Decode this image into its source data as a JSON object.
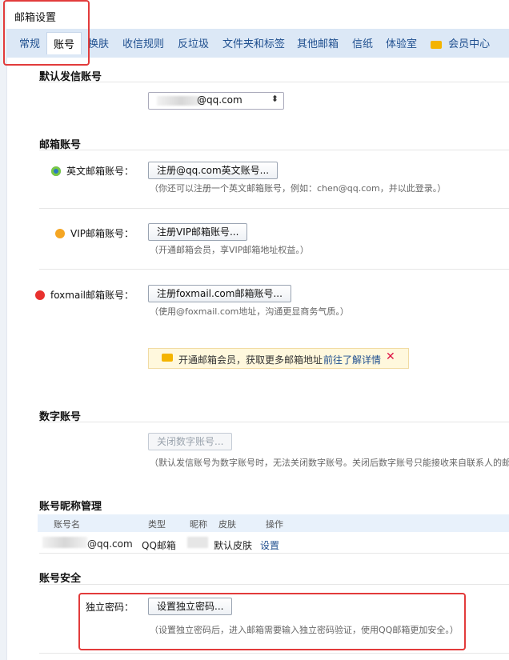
{
  "title": "邮箱设置",
  "tabs": [
    "常规",
    "账号",
    "换肤",
    "收信规则",
    "反垃圾",
    "文件夹和标签",
    "其他邮箱",
    "信纸",
    "体验室"
  ],
  "vip_tab": {
    "icon": "vip-icon",
    "label": "会员中心"
  },
  "default_sender": {
    "title": "默认发信账号",
    "value_suffix": "@qq.com"
  },
  "mail_accounts": {
    "title": "邮箱账号",
    "english": {
      "label": "英文邮箱账号：",
      "button": "注册@qq.com英文账号...",
      "hint": "（你还可以注册一个英文邮箱账号，例如：chen@qq.com，并以此登录。）"
    },
    "vip": {
      "label": "VIP邮箱账号：",
      "button": "注册VIP邮箱账号...",
      "hint": "（开通邮箱会员，享VIP邮箱地址权益。）"
    },
    "foxmail": {
      "label": "foxmail邮箱账号：",
      "button": "注册foxmail.com邮箱账号...",
      "hint": "（使用@foxmail.com地址，沟通更显商务气质。）"
    },
    "promo": {
      "text": "开通邮箱会员，获取更多邮箱地址",
      "link": "前往了解详情",
      "close": "✕"
    }
  },
  "digital_account": {
    "title": "数字账号",
    "button": "关闭数字账号...",
    "hint": "（默认发信账号为数字账号时，无法关闭数字账号。关闭后数字账号只能接收来自联系人的邮件，"
  },
  "nickname": {
    "title": "账号昵称管理",
    "headers": [
      "账号名",
      "类型",
      "昵称",
      "皮肤",
      "操作"
    ],
    "row": {
      "account_suffix": "@qq.com",
      "type": "QQ邮箱",
      "skin": "默认皮肤",
      "action": "设置"
    }
  },
  "security": {
    "title": "账号安全",
    "label": "独立密码：",
    "button": "设置独立密码...",
    "hint": "（设置独立密码后，进入邮箱需要输入独立密码验证，使用QQ邮箱更加安全。）"
  },
  "colors": {
    "annotation": "#e23b3b",
    "tab_text": "#1f4f8f",
    "promo_bg": "#fff8dd"
  }
}
